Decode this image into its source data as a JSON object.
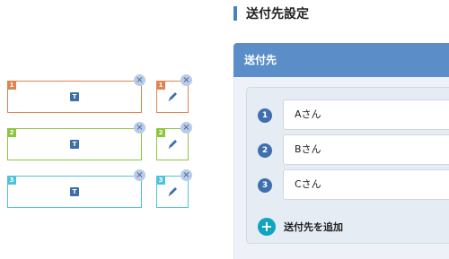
{
  "builder": {
    "rows": [
      {
        "number": "1",
        "color": "#e0834f"
      },
      {
        "number": "2",
        "color": "#8cc63f"
      },
      {
        "number": "3",
        "color": "#4fc3dc"
      }
    ],
    "text_icon_glyph": "T",
    "close_glyph": "×"
  },
  "panel": {
    "section_title": "送付先設定",
    "card_title": "送付先",
    "recipients": [
      {
        "number": "1",
        "name": "Aさん"
      },
      {
        "number": "2",
        "name": "Bさん"
      },
      {
        "number": "3",
        "name": "Cさん"
      }
    ],
    "add_icon": "+",
    "add_label": "送付先を追加"
  },
  "colors": {
    "accent_blue": "#5b8ec9",
    "number_blue": "#3f6fae",
    "add_teal": "#10a3c2"
  }
}
